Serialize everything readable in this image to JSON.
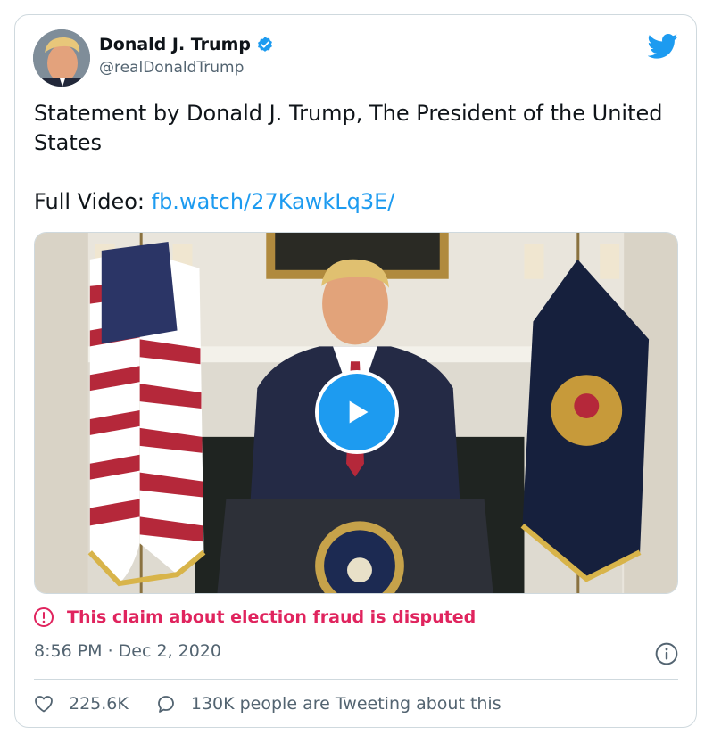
{
  "author": {
    "name": "Donald J. Trump",
    "handle": "@realDonaldTrump",
    "verified": true
  },
  "tweet": {
    "line1": "Statement by Donald J. Trump, The President of the United States",
    "full_video_label": "Full Video: ",
    "link_text": "fb.watch/27KawkLq3E/"
  },
  "notice": {
    "text": "This claim about election fraud is disputed",
    "color": "#e0245e"
  },
  "meta": {
    "timestamp": "8:56 PM · Dec 2, 2020"
  },
  "actions": {
    "likes": "225.6K",
    "conversation": "130K people are Tweeting about this"
  },
  "colors": {
    "accent": "#1d9bf0",
    "muted": "#536471",
    "border": "#cfd9de"
  },
  "icons": [
    "verified-badge-icon",
    "twitter-bird-icon",
    "play-icon",
    "alert-circle-icon",
    "info-icon",
    "heart-icon",
    "speech-bubble-icon"
  ]
}
